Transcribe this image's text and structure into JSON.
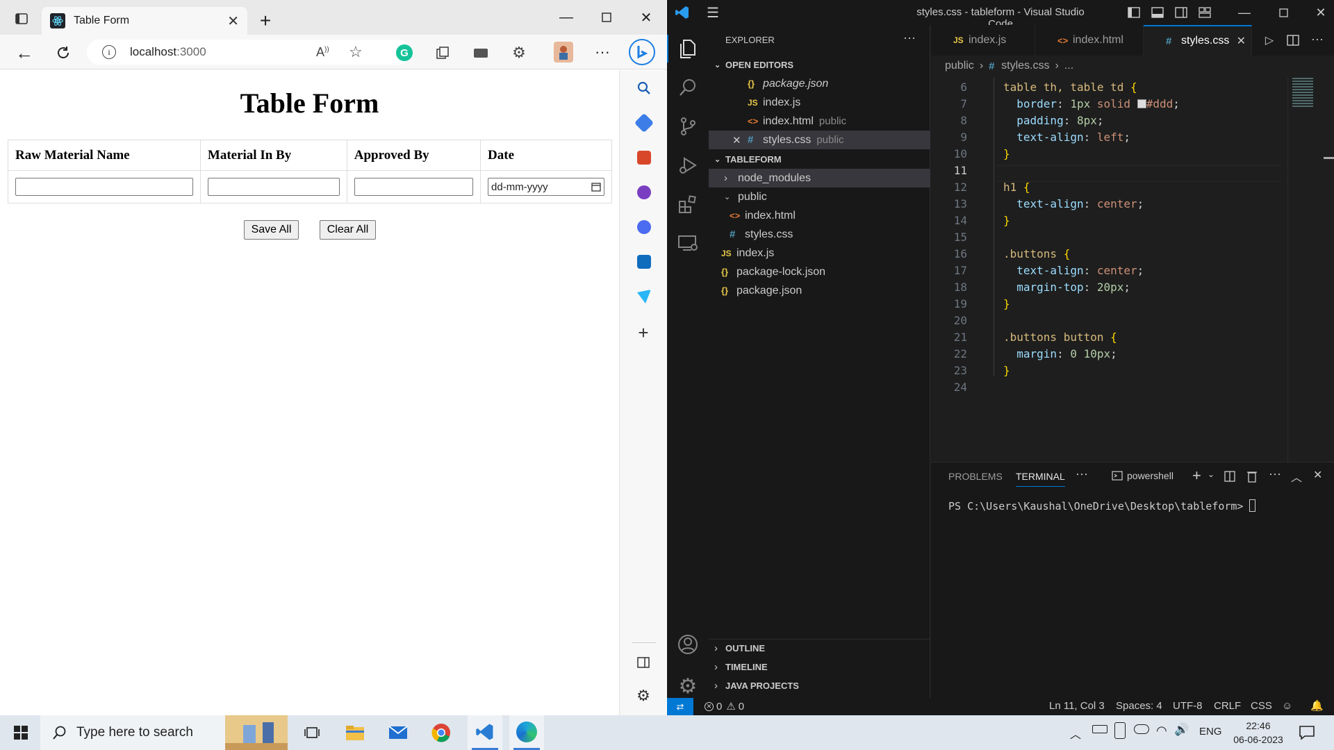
{
  "browser": {
    "tab_title": "Table Form",
    "url_host": "localhost",
    "url_port": ":3000"
  },
  "page": {
    "heading": "Table Form",
    "columns": [
      "Raw Material Name",
      "Material In By",
      "Approved By",
      "Date"
    ],
    "date_placeholder": "dd-mm-yyyy",
    "save_label": "Save All",
    "clear_label": "Clear All"
  },
  "vscode": {
    "window_title": "styles.css - tableform - Visual Studio Code",
    "explorer_title": "EXPLORER",
    "open_editors_title": "OPEN EDITORS",
    "open_editors": [
      {
        "name": "package.json",
        "hint": ""
      },
      {
        "name": "index.js",
        "hint": ""
      },
      {
        "name": "index.html",
        "hint": "public"
      },
      {
        "name": "styles.css",
        "hint": "public"
      }
    ],
    "project_title": "TABLEFORM",
    "tree": [
      "node_modules",
      "public",
      "index.html",
      "styles.css",
      "index.js",
      "package-lock.json",
      "package.json"
    ],
    "tabs": [
      "index.js",
      "index.html",
      "styles.css"
    ],
    "breadcrumb": [
      "public",
      "styles.css",
      "..."
    ],
    "code_lines": [
      {
        "n": "6",
        "t": "table th, table td {"
      },
      {
        "n": "7",
        "t": "  border: 1px solid #ddd;"
      },
      {
        "n": "8",
        "t": "  padding: 8px;"
      },
      {
        "n": "9",
        "t": "  text-align: left;"
      },
      {
        "n": "10",
        "t": "}"
      },
      {
        "n": "11",
        "t": ""
      },
      {
        "n": "12",
        "t": "h1 {"
      },
      {
        "n": "13",
        "t": "  text-align: center;"
      },
      {
        "n": "14",
        "t": "}"
      },
      {
        "n": "15",
        "t": ""
      },
      {
        "n": "16",
        "t": ".buttons {"
      },
      {
        "n": "17",
        "t": "  text-align: center;"
      },
      {
        "n": "18",
        "t": "  margin-top: 20px;"
      },
      {
        "n": "19",
        "t": "}"
      },
      {
        "n": "20",
        "t": ""
      },
      {
        "n": "21",
        "t": ".buttons button {"
      },
      {
        "n": "22",
        "t": "  margin: 0 10px;"
      },
      {
        "n": "23",
        "t": "}"
      },
      {
        "n": "24",
        "t": ""
      }
    ],
    "panel_tabs": [
      "PROBLEMS",
      "TERMINAL"
    ],
    "shell": "powershell",
    "terminal_prompt": "PS C:\\Users\\Kaushal\\OneDrive\\Desktop\\tableform>",
    "sections": [
      "OUTLINE",
      "TIMELINE",
      "JAVA PROJECTS"
    ],
    "status": {
      "errors": "0",
      "warnings": "0",
      "position": "Ln 11, Col 3",
      "spaces": "Spaces: 4",
      "encoding": "UTF-8",
      "eol": "CRLF",
      "language": "CSS"
    }
  },
  "taskbar": {
    "search_placeholder": "Type here to search",
    "language": "ENG",
    "time": "22:46",
    "date": "06-06-2023"
  },
  "colors": {
    "vscode_bg": "#1e1e1e",
    "vscode_accent": "#0078d4",
    "edge_bg": "#f7f7f7"
  }
}
